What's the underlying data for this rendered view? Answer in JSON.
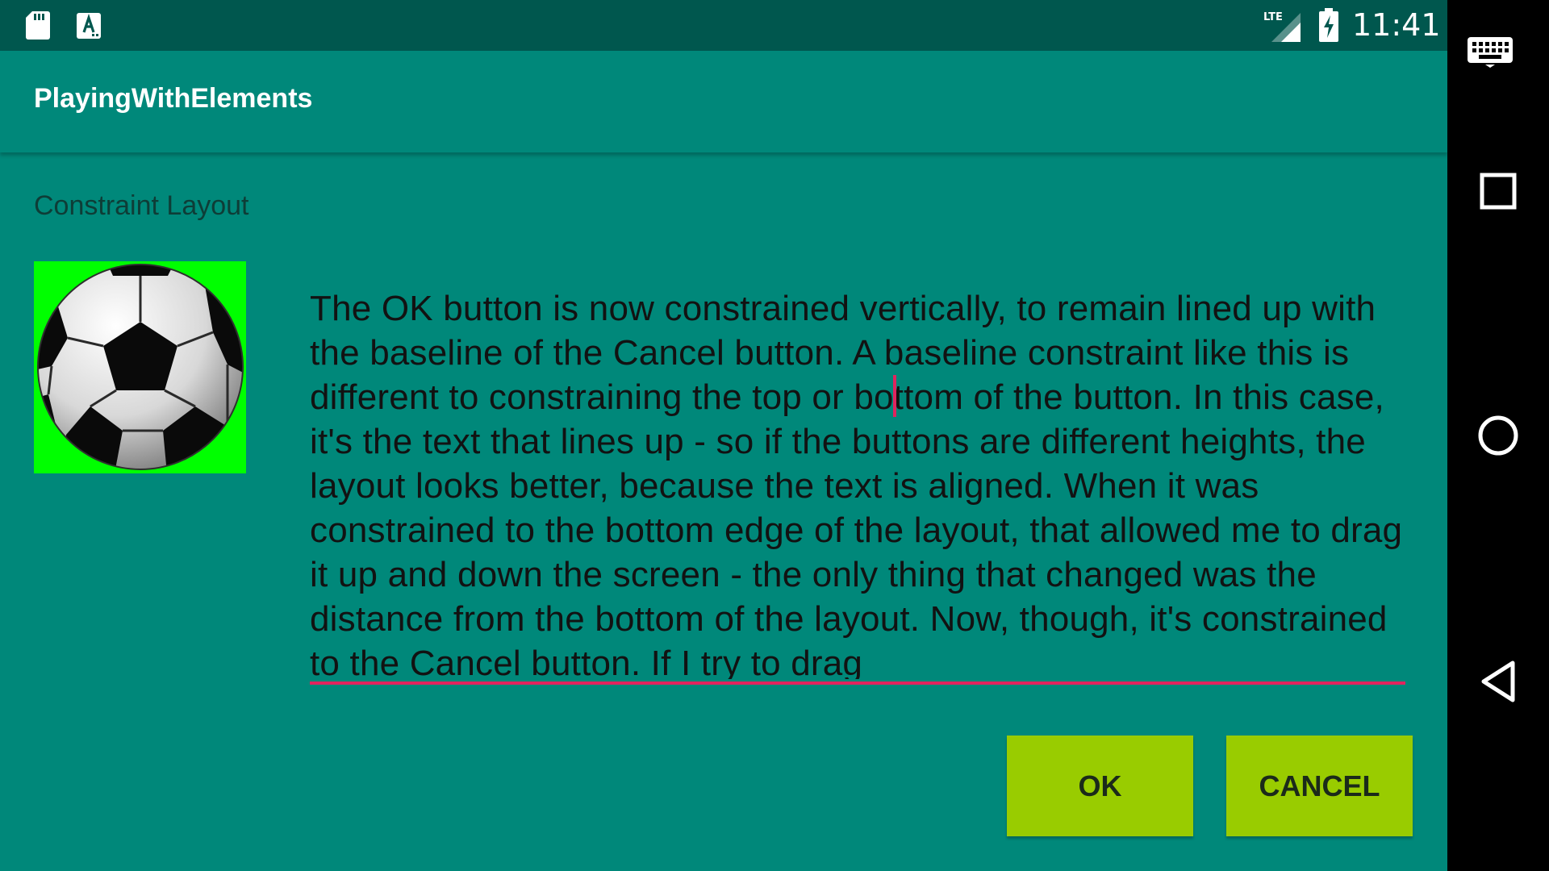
{
  "status_bar": {
    "time": "11:41",
    "network_label": "LTE",
    "icons": [
      "sd-card-icon",
      "text-a-icon",
      "lte-signal-icon",
      "battery-charging-icon"
    ]
  },
  "app_bar": {
    "title": "PlayingWithElements"
  },
  "main": {
    "section_label": "Constraint Layout",
    "image": {
      "icon": "soccer-ball-icon",
      "background_color": "#00ff00"
    },
    "edit_text": {
      "text": "The OK button is now constrained vertically, to remain lined up with the baseline of the Cancel button. A baseline constraint like this is different to constraining the top or bottom of the button. In this case, it's the text that lines up - so if the buttons are different heights, the layout looks better, because the text is aligned. When it was constrained to the bottom edge of the layout, that allowed me to drag it up and down the screen - the only thing that changed was the distance from the bottom of the layout. Now, though, it's constrained to the Cancel button. If I try to drag"
    },
    "ok_button": "OK",
    "cancel_button": "CANCEL"
  },
  "nav_bar": {
    "icons": [
      "keyboard-icon",
      "recents-icon",
      "home-icon",
      "back-icon"
    ]
  },
  "colors": {
    "status_bar": "#00574e",
    "primary": "#00887a",
    "accent": "#e0245e",
    "button": "#99cc00",
    "image_background": "#00ff00",
    "nav_bar": "#000000"
  }
}
